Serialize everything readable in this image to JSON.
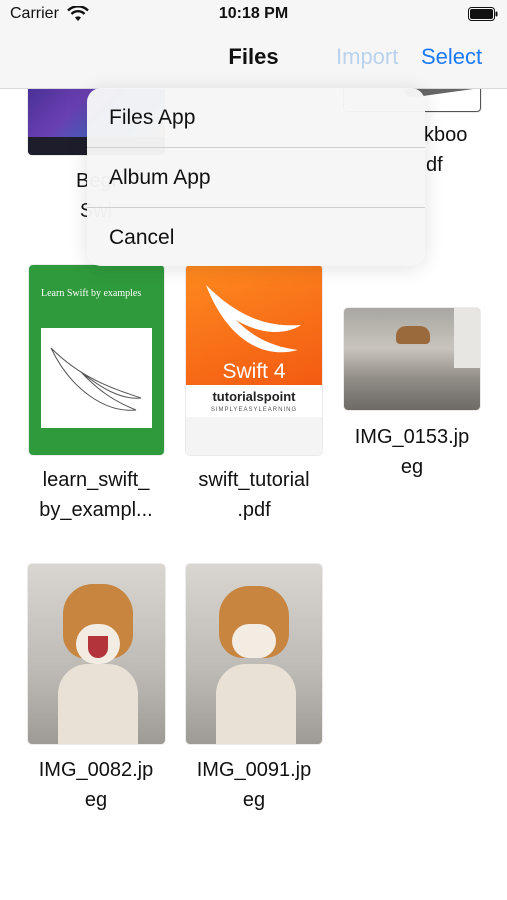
{
  "status_bar": {
    "carrier": "Carrier",
    "time": "10:18 PM",
    "icons": [
      "wifi-icon",
      "battery-icon"
    ]
  },
  "nav": {
    "title": "Files",
    "import_label": "Import",
    "select_label": "Select",
    "colors": {
      "accent": "#1a7af8",
      "disabled": "#b9d3ee"
    }
  },
  "popover": {
    "items": [
      "Files App",
      "Album App",
      "Cancel"
    ]
  },
  "files": {
    "row1": [
      {
        "label_line1": "Begi",
        "label_line2": "Swi"
      },
      {
        "label_line1": "kboo",
        "label_line2": "df"
      }
    ],
    "row2": [
      {
        "label_line1": "learn_swift_",
        "label_line2": "by_exampl...",
        "cover_small": "Learn Swift by examples"
      },
      {
        "label_line1": "swift_tutorial",
        "label_line2": ".pdf",
        "cover_title": "Swift 4",
        "cover_brand": "tutorialspoint",
        "cover_tagline": "SIMPLYEASYLEARNING"
      },
      {
        "label_line1": "IMG_0153.jp",
        "label_line2": "eg"
      }
    ],
    "row3": [
      {
        "label_line1": "IMG_0082.jp",
        "label_line2": "eg"
      },
      {
        "label_line1": "IMG_0091.jp",
        "label_line2": "eg"
      }
    ]
  }
}
